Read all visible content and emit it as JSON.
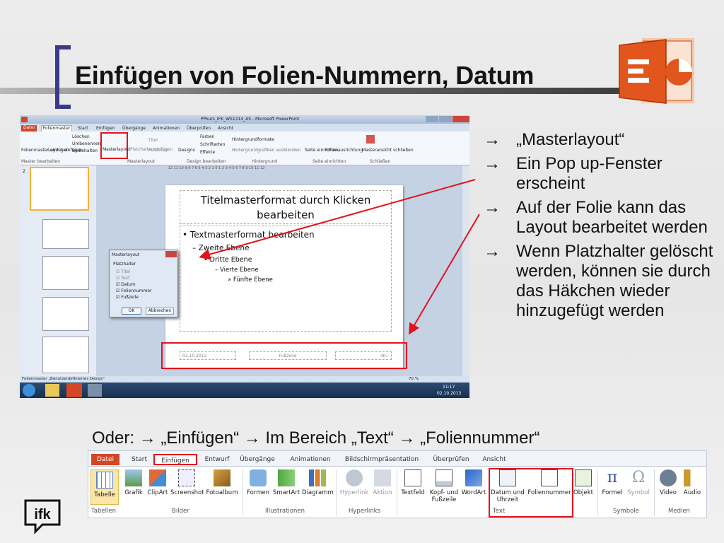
{
  "slide": {
    "title": "Einfügen von Folien-Nummern, Datum",
    "bullets": [
      "„Masterlayout“",
      "Ein Pop up-Fenster erscheint",
      "Auf der Folie kann das Layout bearbeitet werden",
      "Wenn Platzhalter gelöscht werden, können sie durch das Häkchen wieder hinzugefügt werden"
    ],
    "arrow_glyph": "→",
    "oder_line": "Oder: → „Einfügen“ → Im Bereich „Text“ → „Foliennummer“",
    "logo": "ifk"
  },
  "screenshot": {
    "window_title": "PPkurs_IFK_WS1314_AS - Microsoft PowerPoint",
    "tabs": [
      "Datei",
      "Folienmaster",
      "Start",
      "Einfügen",
      "Übergänge",
      "Animationen",
      "Überprüfen",
      "Ansicht"
    ],
    "buttons": [
      "Folienmaster einfügen",
      "Layout einfügen",
      "Löschen",
      "Umbenennen",
      "Beibehalten",
      "Masterlayout",
      "Platzhalter einfügen",
      "Titel",
      "Fußzeilen",
      "Designs",
      "Farben",
      "Schriftarten",
      "Effekte",
      "Hintergrundformate",
      "Hintergrundgrafiken ausblenden",
      "Seite einrichten",
      "Folienausrichtung",
      "Masteransicht schließen"
    ],
    "groups": [
      "Master bearbeiten",
      "Masterlayout",
      "Design bearbeiten",
      "Hintergrund",
      "Seite einrichten",
      "Schließen"
    ],
    "ruler": "·12·11·10·9·8·7·6·5·4·3·2·1·0·1·2·3·4·5·6·7·8·9·10·11·12·",
    "slide_title": "Titelmasterformat durch Klicken bearbeiten",
    "levels": [
      "Textmasterformat bearbeiten",
      "Zweite Ebene",
      "Dritte Ebene",
      "Vierte Ebene",
      "Fünfte Ebene"
    ],
    "footer_date": "02.10.2013",
    "footer_text": "Fußzeile",
    "footer_num": "‹Nr.›",
    "thumb_num": "2",
    "thumb_title": "Titelmasterformat durch Klicken bearbeiten",
    "dialog": {
      "title": "Masterlayout",
      "group": "Platzhalter",
      "items": [
        "Titel",
        "Text",
        "Datum",
        "Foliennummer",
        "Fußzeile"
      ],
      "ok": "OK",
      "cancel": "Abbrechen"
    },
    "status": "Folienmaster  „Benutzerdefiniertes Design“",
    "zoom": "70 %",
    "clock_time": "11:17",
    "clock_date": "02.10.2013"
  },
  "ribbon": {
    "tabs": [
      "Datei",
      "Start",
      "Einfügen",
      "Entwurf",
      "Übergänge",
      "Animationen",
      "Bildschirmpräsentation",
      "Überprüfen",
      "Ansicht"
    ],
    "buttons": [
      "Tabelle",
      "Grafik",
      "ClipArt",
      "Screenshot",
      "Fotoalbum",
      "Formen",
      "SmartArt",
      "Diagramm",
      "Hyperlink",
      "Aktion",
      "Textfeld",
      "Kopf- und Fußzeile",
      "WordArt",
      "Datum und Uhrzeit",
      "Foliennummer",
      "Objekt",
      "Formel",
      "Symbol",
      "Video",
      "Audio"
    ],
    "groups": [
      "Tabellen",
      "Bilder",
      "Illustrationen",
      "Hyperlinks",
      "Text",
      "Symbole",
      "Medien"
    ]
  },
  "colors": {
    "accent_bracket": "#3a3a8c",
    "highlight_red": "#e0141e",
    "ppt_orange": "#e2561d",
    "file_tab": "#d24726"
  }
}
